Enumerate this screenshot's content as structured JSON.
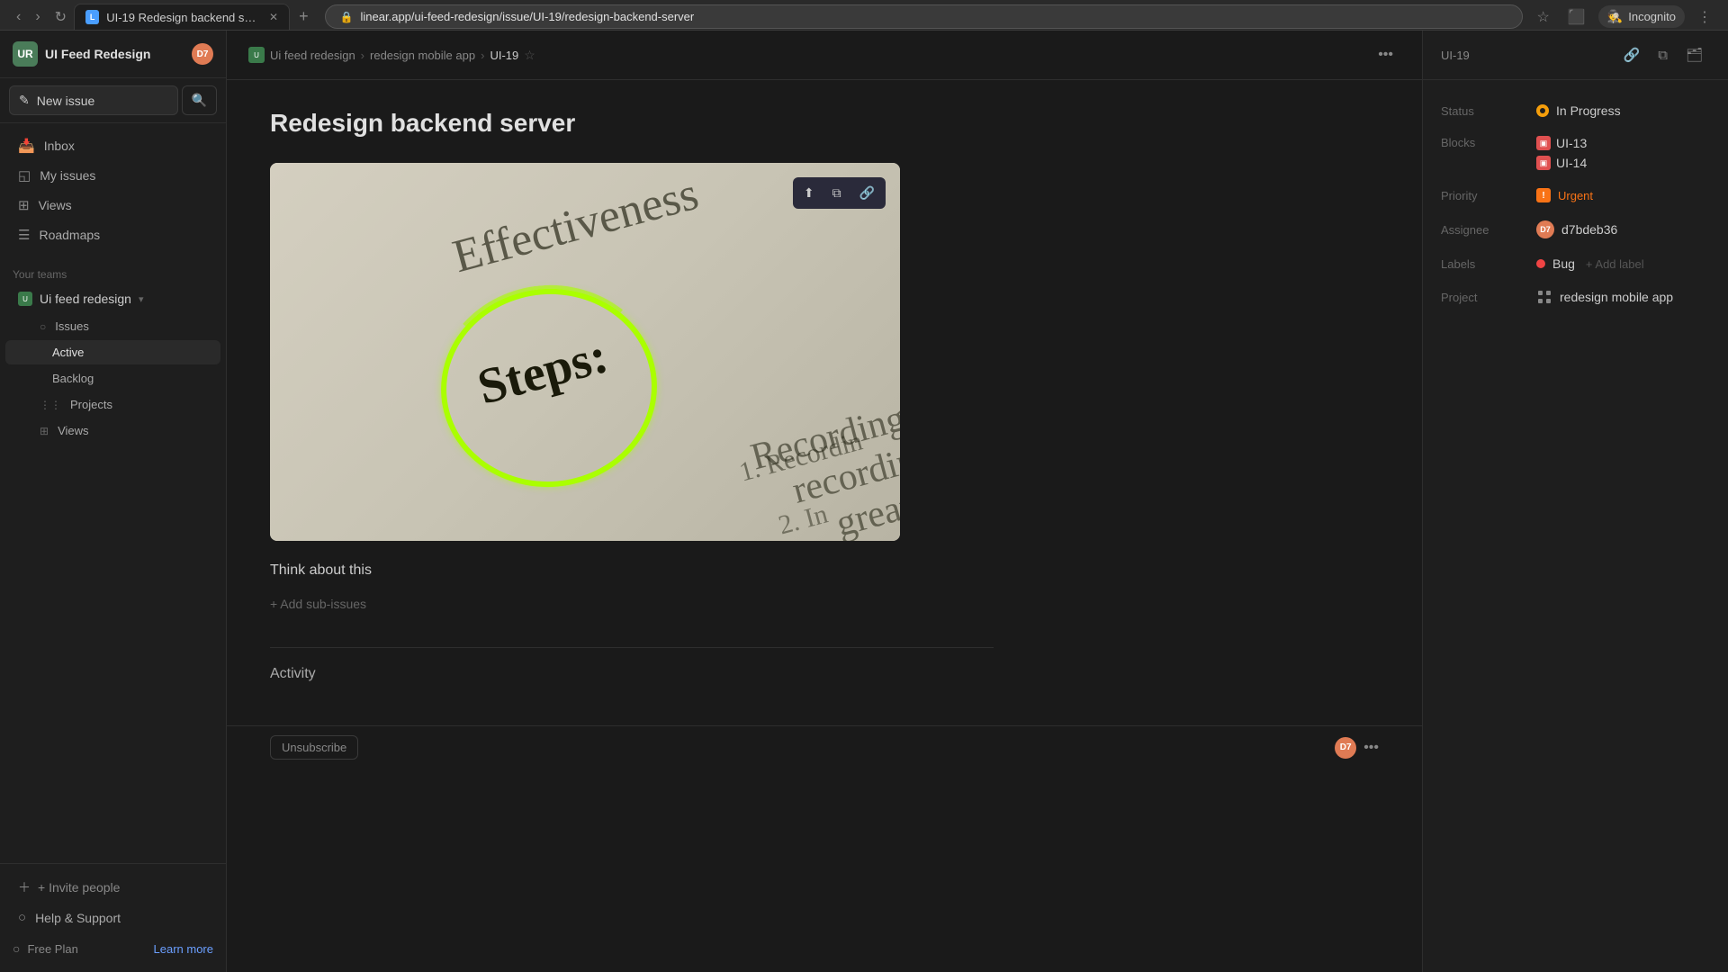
{
  "browser": {
    "tab_title": "UI-19 Redesign backend server",
    "tab_favicon_text": "L",
    "address": "linear.app/ui-feed-redesign/issue/UI-19/redesign-backend-server",
    "incognito_label": "Incognito"
  },
  "sidebar": {
    "workspace_name": "UI Feed Redesign",
    "workspace_avatar_text": "UR",
    "user_avatar_text": "D7",
    "new_issue_label": "New issue",
    "nav_items": [
      {
        "label": "Inbox",
        "icon": "📥"
      },
      {
        "label": "My issues",
        "icon": "◱"
      },
      {
        "label": "Views",
        "icon": "⊞"
      },
      {
        "label": "Roadmaps",
        "icon": "☰"
      }
    ],
    "your_teams_label": "Your teams",
    "team_name": "Ui feed redesign",
    "sub_items": [
      {
        "label": "Issues",
        "icon": "○"
      },
      {
        "label": "Active",
        "icon": "◦",
        "sub": true
      },
      {
        "label": "Backlog",
        "icon": "◦",
        "sub": true
      },
      {
        "label": "Projects",
        "icon": "⋮⋮"
      },
      {
        "label": "Views",
        "icon": "⊞"
      }
    ],
    "invite_people_label": "+ Invite people",
    "help_support_label": "Help & Support",
    "free_plan_label": "Free Plan",
    "learn_more_label": "Learn more"
  },
  "breadcrumb": {
    "team_name": "Ui feed redesign",
    "project_name": "redesign mobile app",
    "issue_id": "UI-19"
  },
  "issue": {
    "title": "Redesign backend server",
    "id_label": "UI-19",
    "think_about_text": "Think about this",
    "add_sub_issues_label": "+ Add sub-issues",
    "activity_label": "Activity",
    "unsubscribe_label": "Unsubscribe"
  },
  "properties": {
    "status_label": "Status",
    "status_value": "In Progress",
    "blocks_label": "Blocks",
    "blocks_items": [
      {
        "id": "UI-13"
      },
      {
        "id": "UI-14"
      }
    ],
    "priority_label": "Priority",
    "priority_value": "Urgent",
    "assignee_label": "Assignee",
    "assignee_value": "d7bdeb36",
    "labels_label": "Labels",
    "label_value": "Bug",
    "add_label_text": "+ Add label",
    "project_label": "Project",
    "project_value": "redesign mobile app"
  },
  "image_toolbar": {
    "upload_icon": "⬆",
    "copy_icon": "⧉",
    "link_icon": "🔗"
  }
}
